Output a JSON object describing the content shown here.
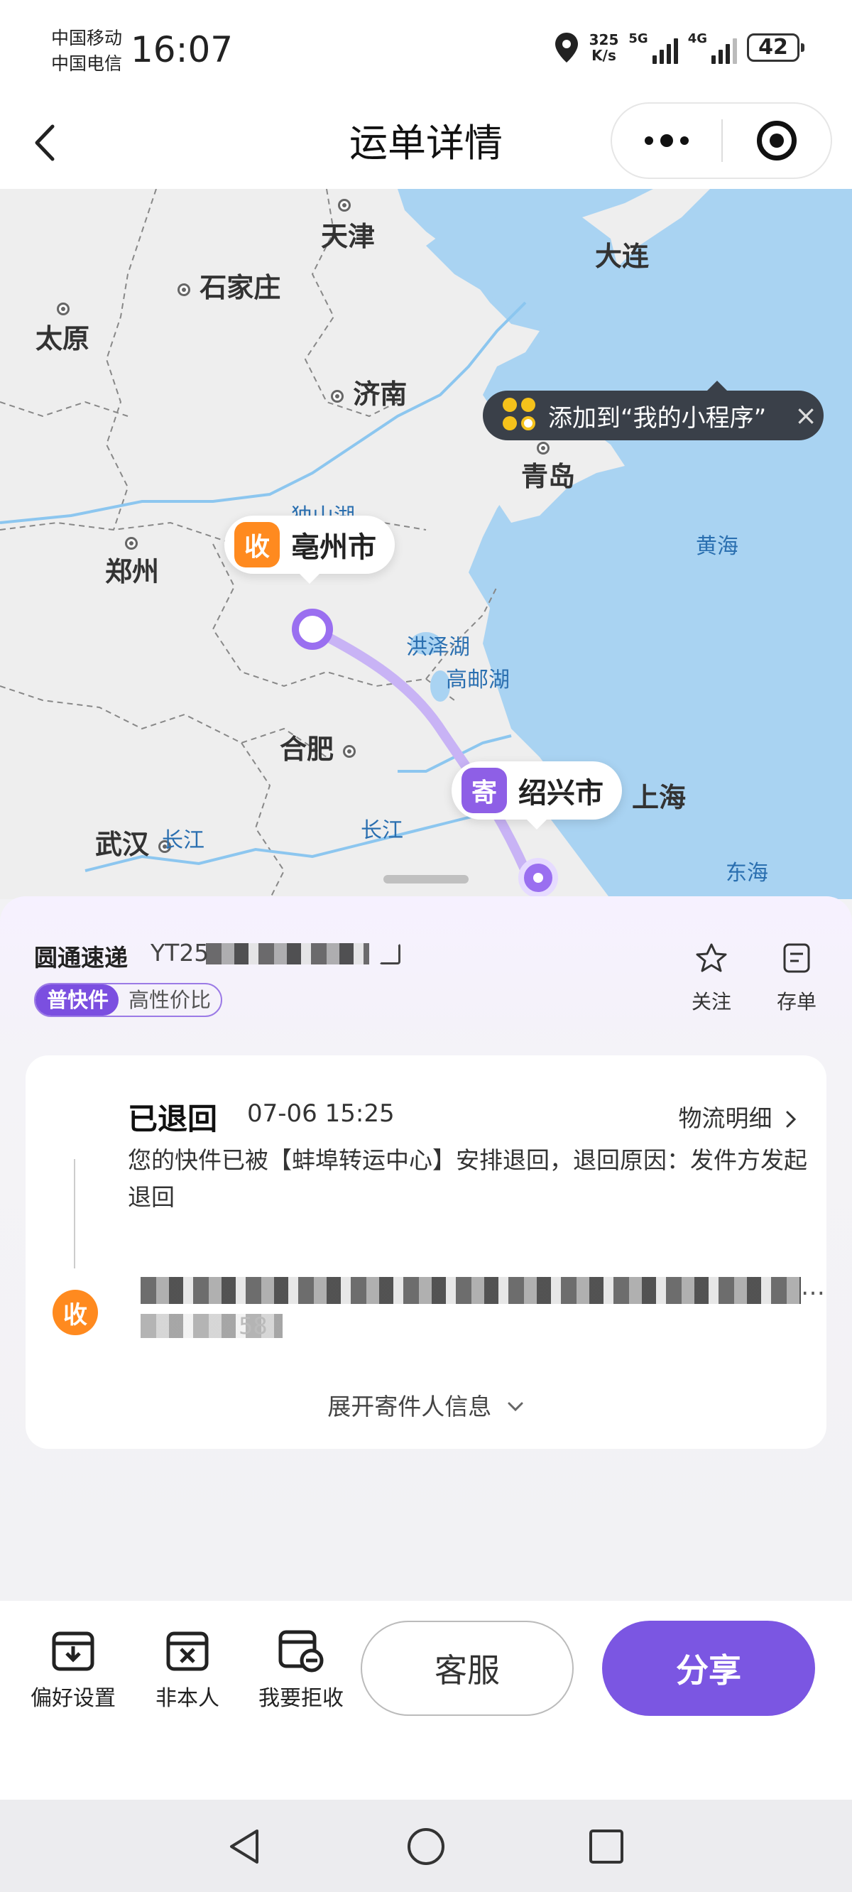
{
  "status_bar": {
    "carrier_1": "中国移动",
    "carrier_2": "中国电信",
    "time": "16:07",
    "net_speed_value": "325",
    "net_speed_unit": "K/s",
    "sig1_label": "5G",
    "sig2_label": "4G",
    "battery": "42"
  },
  "nav": {
    "title": "运单详情"
  },
  "map": {
    "cities": [
      "天津",
      "大连",
      "石家庄",
      "太原",
      "济南",
      "青岛",
      "郑州",
      "合肥",
      "武汉",
      "上海"
    ],
    "waters": [
      "黄海",
      "东海",
      "长江",
      "洪泽湖",
      "高邮湖",
      "独山湖"
    ],
    "water_repeat": "长江",
    "tip_text": "添加到“我的小程序”",
    "tip_close": "×",
    "pin_receive": {
      "tag": "收",
      "name": "亳州市"
    },
    "pin_send": {
      "tag": "寄",
      "name": "绍兴市"
    }
  },
  "shipment": {
    "courier": "圆通速递",
    "waybill_prefix": "YT25",
    "tag_main": "普快件",
    "tag_sub": "高性价比",
    "follow_label": "关注",
    "save_label": "存单"
  },
  "tracking": {
    "status": "已退回",
    "time": "07-06 15:25",
    "detail_link": "物流明细",
    "description": "您的快件已被【蚌埠转运中心】安排退回，退回原因：发件方发起退回",
    "receiver_badge": "收",
    "receiver_ellipsis": "…",
    "receiver_fragment": "58",
    "expand_label": "展开寄件人信息"
  },
  "bottom": {
    "pref_label": "偏好设置",
    "not_me_label": "非本人",
    "reject_label": "我要拒收",
    "service_label": "客服",
    "share_label": "分享"
  },
  "colors": {
    "accent": "#7b56e2",
    "receive_orange": "#ff8a1f",
    "sea": "#a9d3f2",
    "route": "#c8b3f5"
  }
}
